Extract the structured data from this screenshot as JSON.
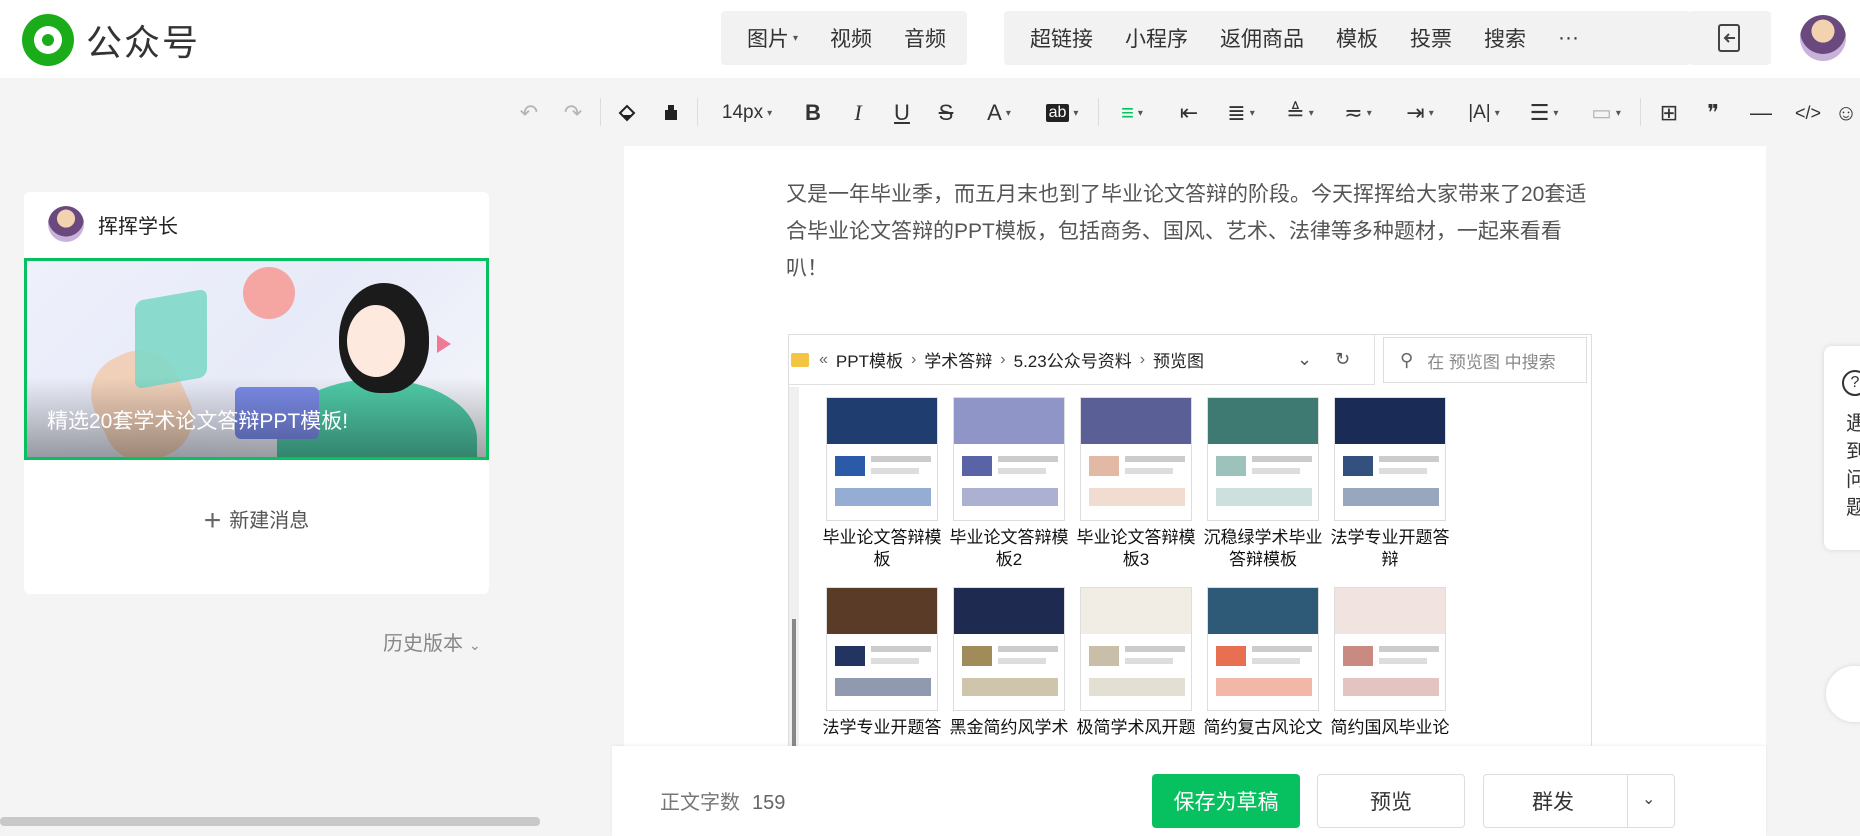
{
  "app": {
    "title": "公众号"
  },
  "header": {
    "media_group": [
      {
        "label": "图片",
        "caret": "▾",
        "icon": "image"
      },
      {
        "label": "视频",
        "caret": "",
        "icon": "video"
      },
      {
        "label": "音频",
        "caret": "",
        "icon": "audio"
      }
    ],
    "insert_group": [
      {
        "label": "超链接"
      },
      {
        "label": "小程序"
      },
      {
        "label": "返佣商品"
      },
      {
        "label": "模板"
      },
      {
        "label": "投票"
      },
      {
        "label": "搜索"
      },
      {
        "label": "···"
      }
    ],
    "exit_icon": "exit-icon",
    "avatar": "user-avatar"
  },
  "toolbar": {
    "font_size": "14px",
    "undo": "↶",
    "redo": "↷",
    "bold": "B",
    "italic": "I",
    "underline": "U",
    "strike": "S",
    "font_color": "A",
    "highlight": "ab",
    "more_icons": [
      "≡",
      "⇤",
      "≣",
      "≜",
      "≂",
      "⇥",
      "|A|",
      "☰",
      "▭",
      "⊞",
      "❞",
      "—",
      "</>",
      "☺"
    ]
  },
  "left": {
    "author": "挥挥学长",
    "cover_title": "精选20套学术论文答辩PPT模板!",
    "new_message": "新建消息",
    "history": "历史版本"
  },
  "editor": {
    "paragraph": "又是一年毕业季，而五月末也到了毕业论文答辩的阶段。今天挥挥给大家带来了20套适合毕业论文答辩的PPT模板，包括商务、国风、艺术、法律等多种题材，一起来看看叭！",
    "explorer": {
      "back_symbol": "«",
      "breadcrumbs": [
        "PPT模板",
        "学术答辩",
        "5.23公众号资料",
        "预览图"
      ],
      "search_placeholder": "在 预览图 中搜索",
      "files": [
        {
          "label": "毕业论文答辩模板",
          "band": "#1f3d6e",
          "accent": "#2b5ba8"
        },
        {
          "label": "毕业论文答辩模板2",
          "band": "#8f95c6",
          "accent": "#5a63a6"
        },
        {
          "label": "毕业论文答辩模板3",
          "band": "#5a5f96",
          "accent": "#e2b9a4"
        },
        {
          "label": "沉稳绿学术毕业答辩模板",
          "band": "#3f7a72",
          "accent": "#9cc2bb"
        },
        {
          "label": "法学专业开题答辩",
          "band": "#1a2c55",
          "accent": "#34507e"
        },
        {
          "label": "法学专业开题答",
          "band": "#5a3b28",
          "accent": "#22345f"
        },
        {
          "label": "黑金简约风学术",
          "band": "#1e2a4f",
          "accent": "#a08c5b"
        },
        {
          "label": "极简学术风开题",
          "band": "#f1ede4",
          "accent": "#c9bfa8"
        },
        {
          "label": "简约复古风论文",
          "band": "#2e5a78",
          "accent": "#e86f52"
        },
        {
          "label": "简约国风毕业论",
          "band": "#f1e3df",
          "accent": "#c98a82"
        }
      ]
    }
  },
  "help": {
    "text": "遇到问题"
  },
  "footer": {
    "word_count_label": "正文字数",
    "word_count": "159",
    "save_draft": "保存为草稿",
    "preview": "预览",
    "mass_send": "群发"
  },
  "colors": {
    "brand_green": "#07c160",
    "logo_green": "#1aad19"
  }
}
